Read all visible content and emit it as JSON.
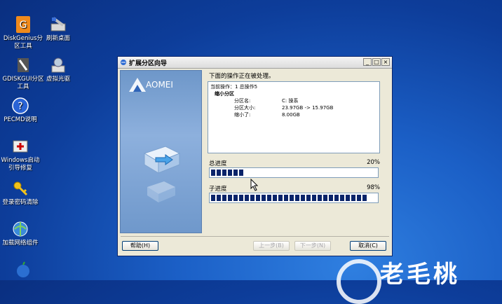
{
  "desktop_icons": [
    {
      "name": "diskgenius-icon",
      "label": "DiskGenius分区工具"
    },
    {
      "name": "refresh-desktop-icon",
      "label": "刷新桌面"
    },
    {
      "name": "gdiskgui-icon",
      "label": "GDISKGUI分区工具"
    },
    {
      "name": "virtual-drive-icon",
      "label": "虚拟光驱"
    },
    {
      "name": "pecmd-help-icon",
      "label": "PECMD说明"
    },
    {
      "name": "windows-boot-repair-icon",
      "label": "Windows启动引导修复"
    },
    {
      "name": "password-clear-icon",
      "label": "登录密码清除"
    },
    {
      "name": "network-component-icon",
      "label": "加载网络组件"
    }
  ],
  "watermark_text": "老毛桃",
  "window": {
    "title": "扩展分区向导",
    "controls": {
      "minimize": "_",
      "maximize": "□",
      "close": "×"
    },
    "brand": "AOMEI",
    "status_heading": "下面的操作正在被处理。",
    "log": {
      "line1": "当前操作：1 总操作5",
      "section": "缩小分区",
      "rows": [
        {
          "key": "分区名:",
          "value": "C: 操系"
        },
        {
          "key": "分区大小:",
          "value": "23.97GB -> 15.97GB"
        },
        {
          "key": "缩小了:",
          "value": "8.00GB"
        }
      ]
    },
    "total_progress": {
      "label": "总进度",
      "percent": "20%",
      "fraction": 0.2
    },
    "sub_progress": {
      "label": "子进度",
      "percent": "98%",
      "fraction": 0.98
    },
    "buttons": {
      "help": "帮助(H)",
      "prev": "上一步(B)",
      "next": "下一步(N)",
      "cancel": "取消(C)"
    }
  }
}
